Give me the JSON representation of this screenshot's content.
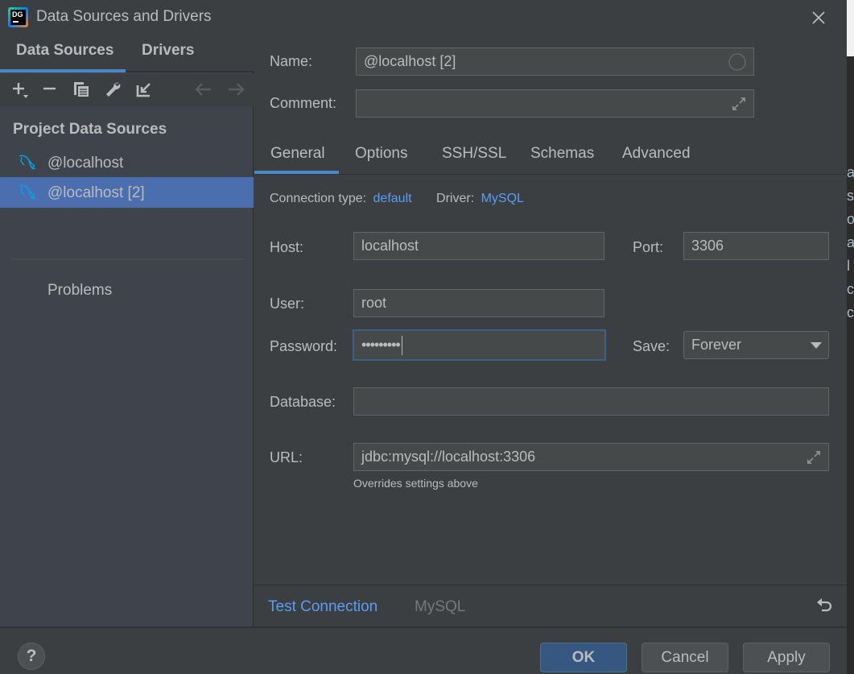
{
  "window": {
    "title": "Data Sources and Drivers",
    "app_logo_text": "DG",
    "close_icon": "close-icon"
  },
  "sidebar": {
    "tabs": [
      {
        "label": "Data Sources",
        "active": true
      },
      {
        "label": "Drivers",
        "active": false
      }
    ],
    "toolbar": [
      {
        "name": "add-icon",
        "glyph": "+"
      },
      {
        "name": "remove-icon",
        "glyph": "−"
      },
      {
        "name": "duplicate-icon",
        "glyph": "copy"
      },
      {
        "name": "wrench-icon",
        "glyph": "settings"
      },
      {
        "name": "import-icon",
        "glyph": "import"
      },
      {
        "name": "back-arrow-icon",
        "glyph": "←"
      },
      {
        "name": "forward-arrow-icon",
        "glyph": "→"
      }
    ],
    "section_title": "Project Data Sources",
    "items": [
      {
        "label": "@localhost",
        "icon": "mysql-dolphin-icon",
        "selected": false
      },
      {
        "label": "@localhost [2]",
        "icon": "mysql-dolphin-icon",
        "selected": true
      }
    ],
    "problems_label": "Problems"
  },
  "form": {
    "name_label": "Name:",
    "name_value": "@localhost [2]",
    "comment_label": "Comment:",
    "comment_value": "",
    "tabs": [
      {
        "label": "General",
        "active": true
      },
      {
        "label": "Options",
        "active": false
      },
      {
        "label": "SSH/SSL",
        "active": false
      },
      {
        "label": "Schemas",
        "active": false
      },
      {
        "label": "Advanced",
        "active": false
      }
    ],
    "connection_type_label": "Connection type:",
    "connection_type_value": "default",
    "driver_label": "Driver:",
    "driver_value": "MySQL",
    "host_label": "Host:",
    "host_value": "localhost",
    "port_label": "Port:",
    "port_value": "3306",
    "user_label": "User:",
    "user_value": "root",
    "password_label": "Password:",
    "password_value": "•••••••••",
    "save_label": "Save:",
    "save_value": "Forever",
    "database_label": "Database:",
    "database_value": "",
    "url_label": "URL:",
    "url_value": "jdbc:mysql://localhost:3306",
    "url_hint": "Overrides settings above"
  },
  "footer": {
    "test_connection": "Test Connection",
    "driver_name": "MySQL"
  },
  "buttons": {
    "help": "?",
    "ok": "OK",
    "cancel": "Cancel",
    "apply": "Apply"
  },
  "colors": {
    "accent": "#4a88c7",
    "link": "#589df6",
    "selection": "#4b6eaf",
    "primary_button": "#365880",
    "mysql_icon": "#00a2e2"
  },
  "background_window": {
    "visible_letters": "a\ns\no\na\nl\nc\nc"
  }
}
